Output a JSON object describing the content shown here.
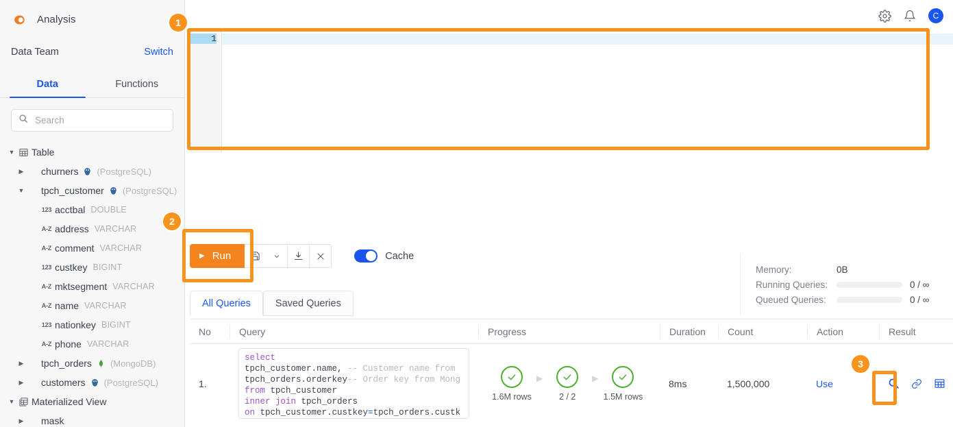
{
  "app": {
    "brand": "Analysis",
    "team": "Data Team",
    "switch_label": "Switch",
    "accent_orange": "#f5841f",
    "accent_blue": "#1a55f0",
    "avatar_initial": "C"
  },
  "header": {
    "gear_icon": "gear-icon",
    "bell_icon": "bell-icon"
  },
  "sidebar": {
    "tabs": [
      {
        "label": "Data",
        "active": true
      },
      {
        "label": "Functions",
        "active": false
      }
    ],
    "search": {
      "placeholder": "Search",
      "value": "",
      "icon": "search-icon"
    },
    "tree": [
      {
        "label": "Table",
        "level": 0,
        "caret": "down",
        "icon": "table-icon",
        "src": "",
        "dtype": ""
      },
      {
        "label": "churners",
        "level": 1,
        "caret": "right",
        "icon": "db-postgres-icon",
        "src": "(PostgreSQL)",
        "dtype": ""
      },
      {
        "label": "tpch_customer",
        "level": 1,
        "caret": "down",
        "icon": "db-postgres-icon",
        "src": "(PostgreSQL)",
        "dtype": ""
      },
      {
        "label": "acctbal",
        "level": 2,
        "caret": "blank",
        "icon": "number-type-icon",
        "src": "",
        "dtype": "DOUBLE"
      },
      {
        "label": "address",
        "level": 2,
        "caret": "blank",
        "icon": "text-type-icon",
        "src": "",
        "dtype": "VARCHAR"
      },
      {
        "label": "comment",
        "level": 2,
        "caret": "blank",
        "icon": "text-type-icon",
        "src": "",
        "dtype": "VARCHAR"
      },
      {
        "label": "custkey",
        "level": 2,
        "caret": "blank",
        "icon": "number-type-icon",
        "src": "",
        "dtype": "BIGINT"
      },
      {
        "label": "mktsegment",
        "level": 2,
        "caret": "blank",
        "icon": "text-type-icon",
        "src": "",
        "dtype": "VARCHAR"
      },
      {
        "label": "name",
        "level": 2,
        "caret": "blank",
        "icon": "text-type-icon",
        "src": "",
        "dtype": "VARCHAR"
      },
      {
        "label": "nationkey",
        "level": 2,
        "caret": "blank",
        "icon": "number-type-icon",
        "src": "",
        "dtype": "BIGINT"
      },
      {
        "label": "phone",
        "level": 2,
        "caret": "blank",
        "icon": "text-type-icon",
        "src": "",
        "dtype": "VARCHAR"
      },
      {
        "label": "tpch_orders",
        "level": 1,
        "caret": "right",
        "icon": "db-mongodb-icon",
        "src": "(MongoDB)",
        "dtype": ""
      },
      {
        "label": "customers",
        "level": 1,
        "caret": "right",
        "icon": "db-postgres-icon",
        "src": "(PostgreSQL)",
        "dtype": ""
      },
      {
        "label": "Materialized View",
        "level": 0,
        "caret": "down",
        "icon": "view-icon",
        "src": "",
        "dtype": ""
      },
      {
        "label": "mask",
        "level": 1,
        "caret": "right",
        "icon": "",
        "src": "",
        "dtype": ""
      }
    ]
  },
  "editor": {
    "line_numbers": [
      "1"
    ],
    "content": ""
  },
  "toolbar": {
    "run_label": "Run",
    "save_icon": "save-icon",
    "chevron_icon": "chevron-down-icon",
    "download_icon": "download-icon",
    "close_icon": "close-icon",
    "cache_label": "Cache",
    "cache_on": true
  },
  "stats": {
    "rows": [
      {
        "label": "Memory:",
        "value": "0B",
        "bar": false
      },
      {
        "label": "Running Queries:",
        "value": "0 / ∞",
        "bar": true
      },
      {
        "label": "Queued Queries:",
        "value": "0 / ∞",
        "bar": true
      }
    ]
  },
  "query_panel": {
    "tabs": [
      {
        "label": "All Queries",
        "active": true
      },
      {
        "label": "Saved Queries",
        "active": false
      }
    ],
    "columns": [
      "No",
      "Query",
      "Progress",
      "Duration",
      "Count",
      "Action",
      "Result"
    ],
    "rows": [
      {
        "no": "1.",
        "sql_lines": [
          [
            {
              "t": "select",
              "c": "kw"
            }
          ],
          [
            {
              "t": "tpch_customer.name, ",
              "c": ""
            },
            {
              "t": "-- Customer name from",
              "c": "cm"
            }
          ],
          [
            {
              "t": "tpch_orders.orderkey",
              "c": ""
            },
            {
              "t": "-- Order key from Mong",
              "c": "cm"
            }
          ],
          [
            {
              "t": "from",
              "c": "kw"
            },
            {
              "t": " tpch_customer",
              "c": ""
            }
          ],
          [
            {
              "t": "inner join",
              "c": "kw"
            },
            {
              "t": " tpch_orders",
              "c": ""
            }
          ],
          [
            {
              "t": "on",
              "c": "kw"
            },
            {
              "t": " tpch_customer.custkey",
              "c": ""
            },
            {
              "t": "=",
              "c": "op"
            },
            {
              "t": "tpch_orders.custk",
              "c": ""
            }
          ]
        ],
        "progress": [
          {
            "status": "done",
            "label": "1.6M rows"
          },
          {
            "status": "done",
            "label": "2 / 2"
          },
          {
            "status": "done",
            "label": "1.5M rows"
          }
        ],
        "duration": "8ms",
        "count": "1,500,000",
        "action": "Use",
        "result_icons": [
          "search-icon",
          "link-icon",
          "grid-icon"
        ]
      }
    ]
  },
  "annotations": {
    "badges": [
      {
        "n": "1",
        "target": "editor"
      },
      {
        "n": "2",
        "target": "run-button"
      },
      {
        "n": "3",
        "target": "result-search-icon"
      }
    ]
  }
}
